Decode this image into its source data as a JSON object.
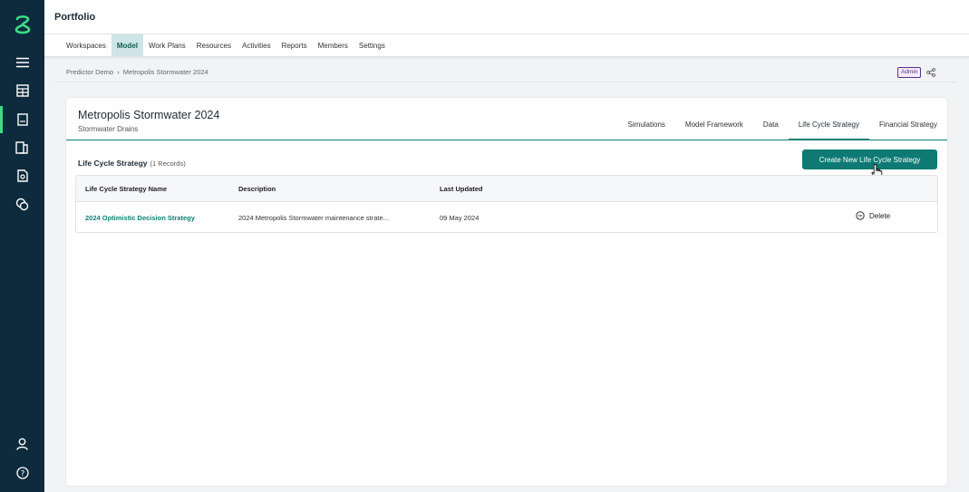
{
  "app": {
    "title": "Portfolio"
  },
  "sidebar": {
    "icons": [
      {
        "name": "logo-icon"
      },
      {
        "name": "menu-icon"
      },
      {
        "name": "table-icon"
      },
      {
        "name": "model-icon",
        "active": true
      },
      {
        "name": "files-icon"
      },
      {
        "name": "document-icon"
      },
      {
        "name": "coins-icon"
      },
      {
        "name": "user-icon"
      },
      {
        "name": "help-icon"
      }
    ]
  },
  "nav": {
    "items": [
      "Workspaces",
      "Model",
      "Work Plans",
      "Resources",
      "Activities",
      "Reports",
      "Members",
      "Settings"
    ],
    "active": "Model"
  },
  "breadcrumb": {
    "parent": "Predictor Demo",
    "separator": "›",
    "current": "Metropolis Stormwater 2024",
    "badge": "Admin"
  },
  "model": {
    "title": "Metropolis Stormwater 2024",
    "subtitle": "Stormwater Drains",
    "tabs": [
      "Simulations",
      "Model Framework",
      "Data",
      "Life Cycle Strategy",
      "Financial Strategy"
    ],
    "active_tab": "Life Cycle Strategy"
  },
  "section": {
    "title": "Life Cycle Strategy",
    "count": "(1 Records)",
    "create_label": "Create New Life Cycle Strategy"
  },
  "table": {
    "headers": [
      "Life Cycle Strategy Name",
      "Description",
      "Last Updated"
    ],
    "rows": [
      {
        "name": "2024 Optimistic Decision Strategy",
        "description": "2024 Metropolis Stormwater maintenance strate...",
        "updated": "09 May 2024",
        "action": "Delete"
      }
    ]
  },
  "colors": {
    "sidebar": "#0d2b3c",
    "accent": "#0e7a73",
    "logo": "#3ddc84",
    "badge": "#5b2e8f"
  }
}
